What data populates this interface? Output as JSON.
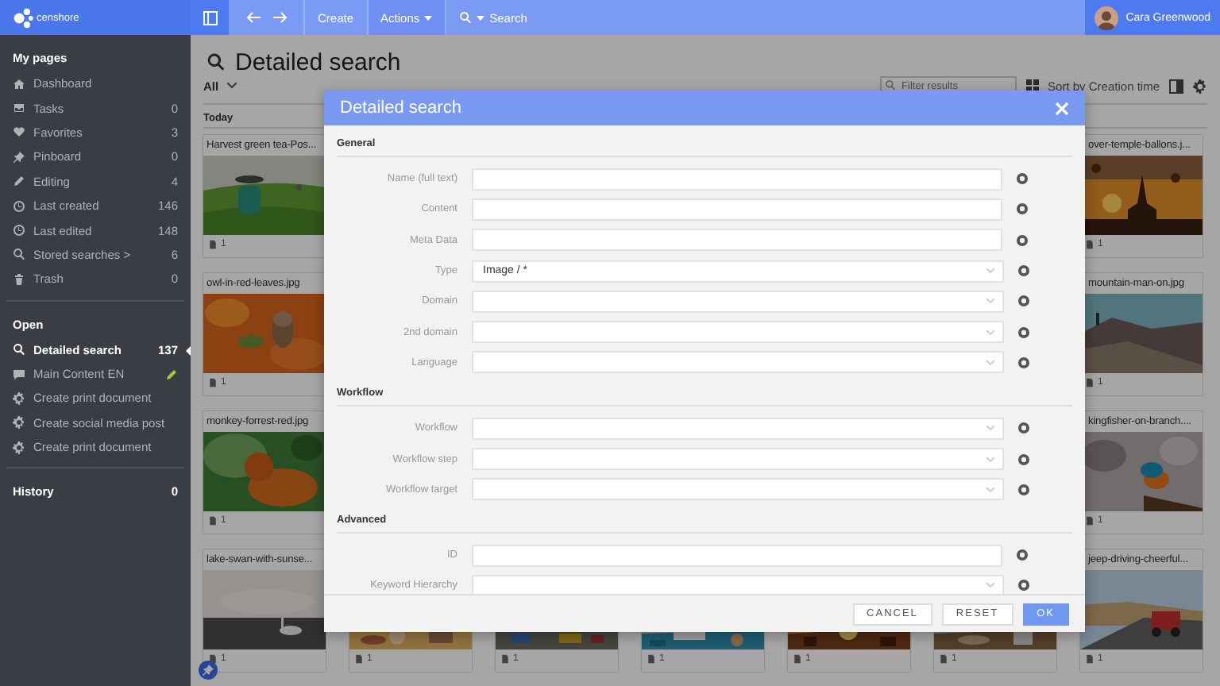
{
  "topbar": {
    "create": "Create",
    "actions": "Actions",
    "search": "Search",
    "user": "Cara Greenwood"
  },
  "sidebar": {
    "logo": "censhore",
    "sections": [
      {
        "title": "My pages",
        "items": [
          {
            "label": "Dashboard"
          },
          {
            "label": "Tasks",
            "count": "0"
          },
          {
            "label": "Favorites",
            "count": "3"
          },
          {
            "label": "Pinboard",
            "count": "0"
          },
          {
            "label": "Editing",
            "count": "4"
          },
          {
            "label": "Last created",
            "count": "146"
          },
          {
            "label": "Last edited",
            "count": "148"
          },
          {
            "label": "Stored searches >",
            "count": "6"
          },
          {
            "label": "Trash",
            "count": "0"
          }
        ]
      },
      {
        "title": "Open",
        "items": [
          {
            "label": "Detailed search",
            "count": "137",
            "selected": true,
            "editing": false
          },
          {
            "label": "Main Content EN",
            "selected": false,
            "editing": true
          },
          {
            "label": "Create print document",
            "selected": false,
            "editing": false
          },
          {
            "label": "Create social media post",
            "selected": false,
            "editing": false
          },
          {
            "label": "Create print document",
            "selected": false,
            "editing": false
          }
        ]
      },
      {
        "title": "History",
        "count": "0"
      }
    ]
  },
  "main": {
    "title": "Detailed search",
    "filter": "All",
    "filter_placeholder": "Filter results",
    "sort": "Sort by Creation time",
    "group": "Today",
    "rows": [
      [
        {
          "name": "Harvest green tea-Pos...",
          "count": "1"
        },
        null,
        null,
        null,
        null,
        null,
        {
          "name": "over-temple-ballons.j...",
          "count": "1"
        }
      ],
      [
        {
          "name": "owl-in-red-leaves.jpg",
          "count": "1"
        },
        null,
        null,
        null,
        null,
        null,
        {
          "name": "mountain-man-on.jpg",
          "count": "1"
        }
      ],
      [
        {
          "name": "monkey-forrest-red.jpg",
          "count": "1"
        },
        null,
        null,
        null,
        null,
        null,
        {
          "name": "kingfisher-on-branch....",
          "count": "1"
        }
      ],
      [
        {
          "name": "lake-swan-with-sunse...",
          "count": "1"
        },
        {
          "count": "1"
        },
        {
          "count": "1"
        },
        {
          "count": "1"
        },
        {
          "count": "1"
        },
        {
          "count": "1"
        },
        {
          "name": "jeep-driving-cheerful...",
          "count": "1"
        }
      ]
    ]
  },
  "dialog": {
    "title": "Detailed search",
    "sections": [
      {
        "title": "General",
        "fields": [
          {
            "label": "Name (full text)",
            "kind": "text"
          },
          {
            "label": "Content",
            "kind": "text"
          },
          {
            "label": "Meta Data",
            "kind": "text"
          },
          {
            "label": "Type",
            "kind": "select",
            "value": "Image / *"
          },
          {
            "label": "Domain",
            "kind": "select"
          },
          {
            "label": "2nd domain",
            "kind": "select"
          },
          {
            "label": "Language",
            "kind": "select"
          }
        ]
      },
      {
        "title": "Workflow",
        "fields": [
          {
            "label": "Workflow",
            "kind": "select"
          },
          {
            "label": "Workflow step",
            "kind": "select"
          },
          {
            "label": "Workflow target",
            "kind": "select"
          }
        ]
      },
      {
        "title": "Advanced",
        "fields": [
          {
            "label": "ID",
            "kind": "text"
          },
          {
            "label": "Keyword Hierarchy",
            "kind": "select"
          }
        ]
      }
    ],
    "buttons": [
      {
        "label": "CANCEL",
        "primary": false
      },
      {
        "label": "RESET",
        "primary": false
      },
      {
        "label": "OK",
        "primary": true
      }
    ]
  }
}
